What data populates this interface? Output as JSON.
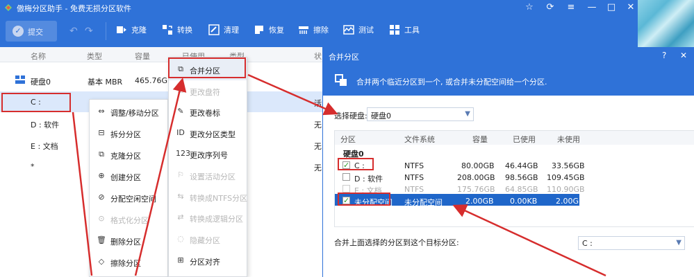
{
  "app": {
    "title": "傲梅分区助手 - 免费无损分区软件",
    "window_controls": [
      "☆",
      "⟳",
      "≡",
      "—",
      "□",
      "✕"
    ]
  },
  "toolbar": {
    "commit": "提交",
    "items": [
      "克隆",
      "转换",
      "清理",
      "恢复",
      "擦除",
      "测试",
      "工具"
    ]
  },
  "table": {
    "headers": [
      "名称",
      "类型",
      "容量",
      "已使用",
      "类型",
      "状"
    ],
    "disk": {
      "name": "硬盘0",
      "type": "基本 MBR",
      "capacity": "465.76GB"
    },
    "partitions": [
      {
        "name": "C :",
        "status": "活"
      },
      {
        "name": "D : 软件",
        "status": "无"
      },
      {
        "name": "E : 文档",
        "status": "无"
      },
      {
        "name": "*",
        "status": "无"
      }
    ]
  },
  "menu_left": [
    {
      "icon": "resize-icon",
      "label": "调整/移动分区",
      "disabled": false
    },
    {
      "icon": "split-icon",
      "label": "拆分分区",
      "disabled": false
    },
    {
      "icon": "clone-icon",
      "label": "克隆分区",
      "disabled": false
    },
    {
      "icon": "create-icon",
      "label": "创建分区",
      "disabled": false
    },
    {
      "icon": "allocate-icon",
      "label": "分配空闲空间",
      "disabled": false
    },
    {
      "icon": "format-icon",
      "label": "格式化分区",
      "disabled": true
    },
    {
      "icon": "delete-icon",
      "label": "删除分区",
      "disabled": false
    },
    {
      "icon": "wipe-icon",
      "label": "擦除分区",
      "disabled": false
    }
  ],
  "menu_right": [
    {
      "icon": "merge-icon",
      "label": "合并分区",
      "disabled": false
    },
    {
      "icon": "drive-letter-icon",
      "label": "更改盘符",
      "disabled": true
    },
    {
      "icon": "label-icon",
      "label": "更改卷标",
      "disabled": false
    },
    {
      "icon": "id-icon",
      "label": "更改分区类型",
      "disabled": false
    },
    {
      "icon": "serial-icon",
      "label": "更改序列号",
      "disabled": false
    },
    {
      "icon": "active-icon",
      "label": "设置活动分区",
      "disabled": true
    },
    {
      "icon": "convert-ntfs-icon",
      "label": "转换成NTFS分区",
      "disabled": true
    },
    {
      "icon": "convert-logical-icon",
      "label": "转换成逻辑分区",
      "disabled": true
    },
    {
      "icon": "hide-icon",
      "label": "隐藏分区",
      "disabled": true
    },
    {
      "icon": "align-icon",
      "label": "分区对齐",
      "disabled": false
    }
  ],
  "menu_right_glyphs": [
    "⧉",
    "⚿",
    "✎",
    "ID",
    "123",
    "⚐",
    "⇆",
    "⇄",
    "◌",
    "⊞"
  ],
  "menu_left_glyphs": [
    "⇔",
    "⊟",
    "⧉",
    "⊕",
    "⊘",
    "⊙",
    "🗑",
    "◇"
  ],
  "dialog": {
    "title": "合并分区",
    "help": "?",
    "close": "✕",
    "description": "合并两个临近分区到一个, 或合并未分配空间给一个分区.",
    "disk_label": "选择硬盘:",
    "disk_value": "硬盘0",
    "table_headers": [
      "分区",
      "文件系统",
      "容量",
      "已使用",
      "未使用"
    ],
    "group": "硬盘0",
    "rows": [
      {
        "name": "C :",
        "fs": "NTFS",
        "capacity": "80.00GB",
        "used": "46.44GB",
        "free": "33.56GB",
        "checked": true,
        "disabled": false,
        "selected": false
      },
      {
        "name": "D : 软件",
        "fs": "NTFS",
        "capacity": "208.00GB",
        "used": "98.56GB",
        "free": "109.45GB",
        "checked": false,
        "disabled": false,
        "selected": false
      },
      {
        "name": "E : 文档",
        "fs": "NTFS",
        "capacity": "175.76GB",
        "used": "64.85GB",
        "free": "110.90GB",
        "checked": false,
        "disabled": true,
        "selected": false
      },
      {
        "name": "未分配空间",
        "fs": "未分配空间",
        "capacity": "2.00GB",
        "used": "0.00KB",
        "free": "2.00GB",
        "checked": true,
        "disabled": false,
        "selected": true
      }
    ],
    "target_label": "合并上面选择的分区到这个目标分区:",
    "target_value": "C :"
  },
  "colors": {
    "accent": "#2f72d8",
    "highlight": "#d62d2d",
    "selected_row": "#1f66c9"
  }
}
